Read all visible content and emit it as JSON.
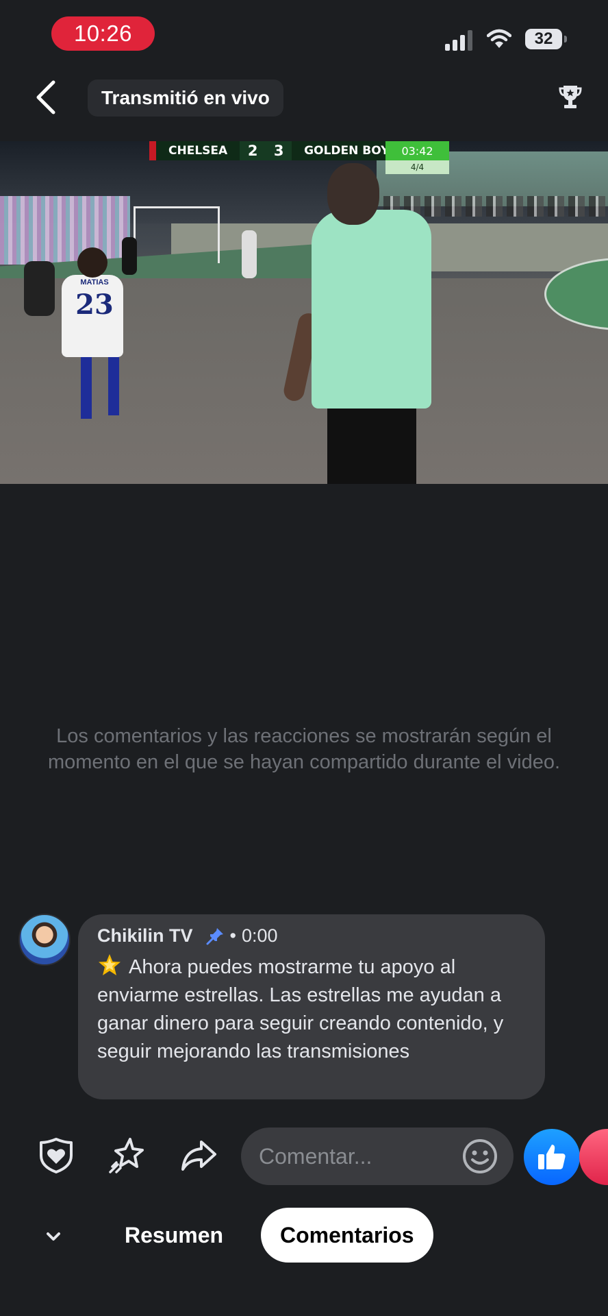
{
  "status_bar": {
    "time": "10:26",
    "battery": "32"
  },
  "header": {
    "title": "Transmitió en vivo"
  },
  "video": {
    "team_home": "CHELSEA",
    "score_home": "2",
    "score_away": "3",
    "team_away": "GOLDEN BOYS",
    "clock": "03:42",
    "period": "4/4",
    "jersey_name": "MATIAS",
    "jersey_number": "23"
  },
  "info_text": "Los comentarios y las reacciones se mostrarán según el momento en el que se hayan compartido durante el video.",
  "comment": {
    "author": "Chikilin TV",
    "separator": "•",
    "timestamp": "0:00",
    "text": "Ahora puedes mostrarme tu apoyo al enviarme estrellas. Las estrellas me ayudan a ganar dinero para seguir creando contenido, y seguir mejorando las transmisiones"
  },
  "actions": {
    "comment_placeholder": "Comentar..."
  },
  "tabs": {
    "summary": "Resumen",
    "comments": "Comentarios"
  },
  "colors": {
    "background": "#1c1e21",
    "time_pill": "#e0243a",
    "like_blue": "#0866ff",
    "love_red": "#e0244a"
  },
  "icons": [
    "signal-icon",
    "wifi-icon",
    "back-arrow-icon",
    "trophy-icon",
    "pin-icon",
    "star-emoji-icon",
    "heart-shield-icon",
    "sparkle-star-icon",
    "share-arrow-icon",
    "smiley-icon",
    "thumbs-up-icon",
    "heart-icon",
    "chevron-down-icon"
  ]
}
